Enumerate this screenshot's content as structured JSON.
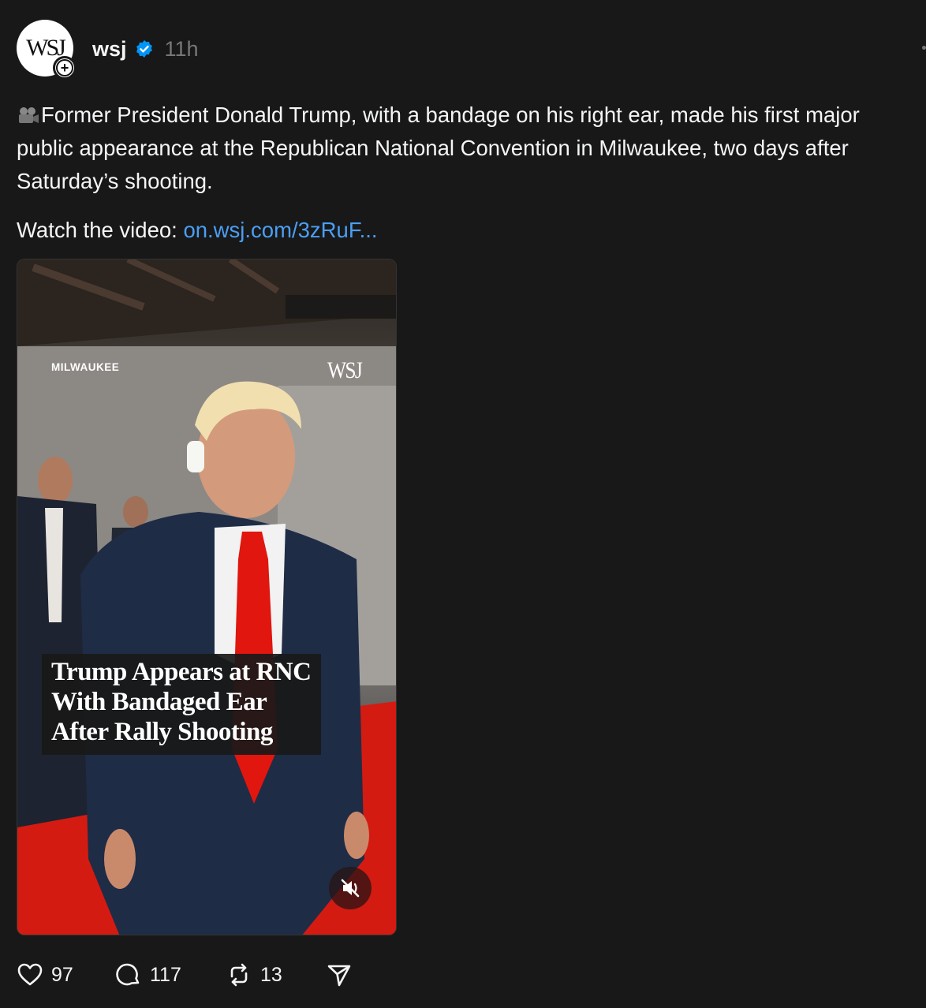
{
  "post": {
    "avatar_text": "WSJ",
    "username": "wsj",
    "time": "11h",
    "caption": "Former President Donald Trump, with a bandage on his right ear, made his first major public appearance at the Republican National Convention in Milwaukee, two days after Saturday’s shooting.",
    "watch_prefix": "Watch the video: ",
    "link_text": "on.wsj.com/3zRuF..."
  },
  "video": {
    "location": "MILWAUKEE",
    "brand": "WSJ",
    "headline": "Trump Appears at RNC With Bandaged Ear After Rally Shooting",
    "muted": true
  },
  "actions": {
    "likes": "97",
    "replies": "117",
    "reposts": "13"
  },
  "icons": [
    "follow-plus-icon",
    "verified-badge-icon",
    "movie-camera-icon",
    "mute-icon",
    "heart-icon",
    "comment-icon",
    "repost-icon",
    "share-icon"
  ],
  "colors": {
    "background": "#181818",
    "link": "#4a9ff5",
    "verified": "#0095f6",
    "muted_text": "#777777"
  }
}
